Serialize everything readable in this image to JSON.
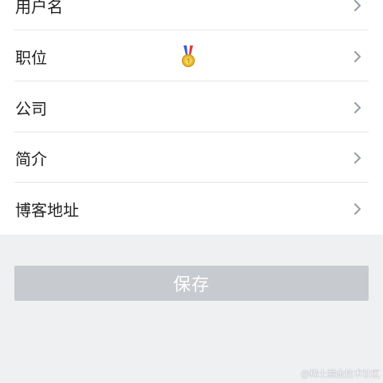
{
  "rows": [
    {
      "label": "用户名",
      "icon": "chevron-right-icon"
    },
    {
      "label": "职位",
      "icon": "chevron-right-icon",
      "badge_icon": "medal-icon"
    },
    {
      "label": "公司",
      "icon": "chevron-right-icon"
    },
    {
      "label": "简介",
      "icon": "chevron-right-icon"
    },
    {
      "label": "博客地址",
      "icon": "chevron-right-icon"
    }
  ],
  "save_button": {
    "label": "保存"
  },
  "watermark": "@稀土掘金技术社区",
  "colors": {
    "page_background": "#eef0f2",
    "list_background": "#ffffff",
    "divider": "#e4e6e9",
    "label_text": "#222222",
    "chevron": "#9aa0a8",
    "save_button_background": "#c7cacf",
    "save_button_text": "#ffffff"
  }
}
